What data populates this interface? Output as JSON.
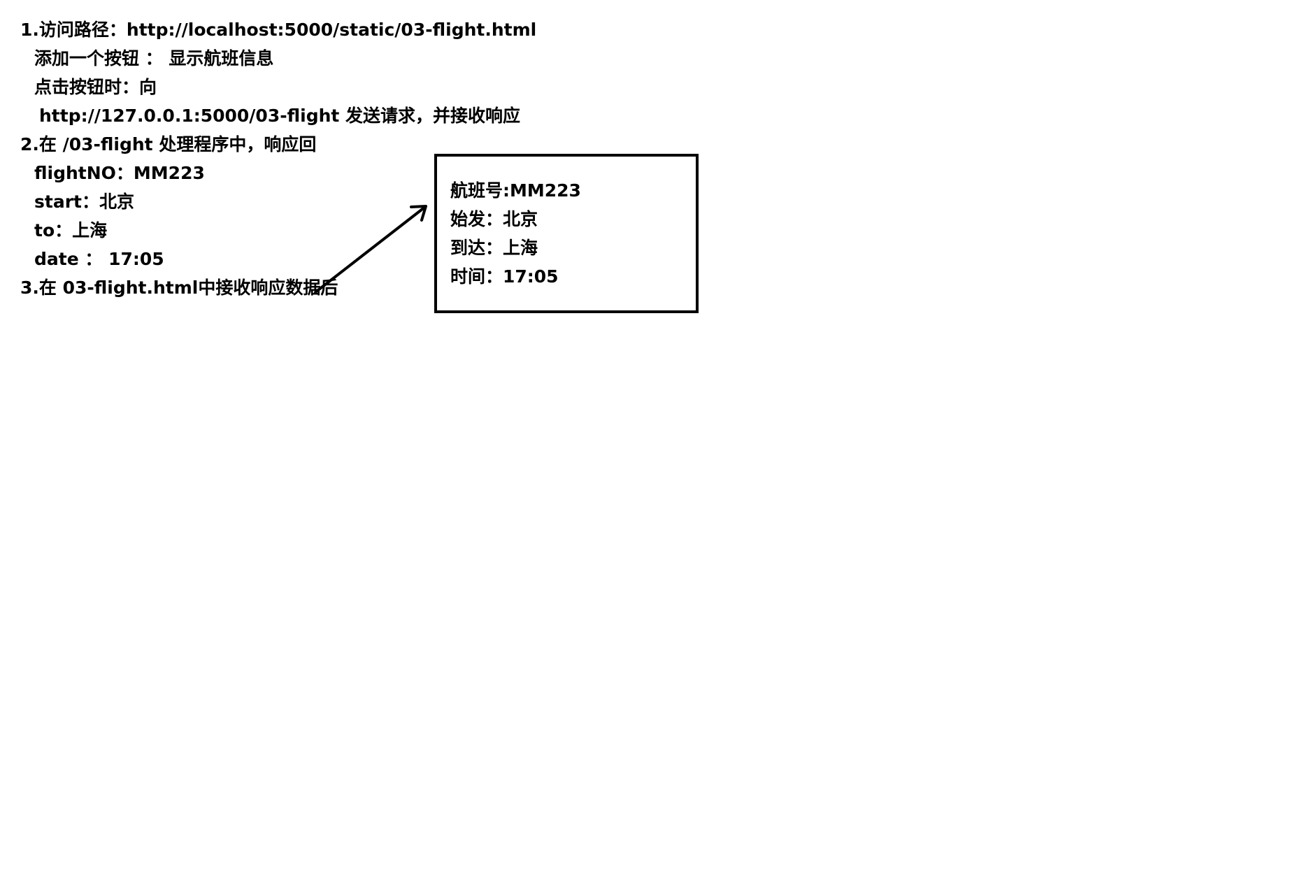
{
  "instructions": [
    {
      "text": "1.访问路径：http://localhost:5000/static/03-flight.html",
      "indent": 0
    },
    {
      "text": "添加一个按钮 ： 显示航班信息",
      "indent": 1
    },
    {
      "text": "点击按钮时：向",
      "indent": 1
    },
    {
      "text": "http://127.0.0.1:5000/03-flight  发送请求，并接收响应",
      "indent": 2
    },
    {
      "text": "2.在 /03-flight 处理程序中，响应回",
      "indent": 0
    },
    {
      "text": "flightNO：MM223",
      "indent": 1
    },
    {
      "text": "start：北京",
      "indent": 1
    },
    {
      "text": "to：上海",
      "indent": 1
    },
    {
      "text": "date ： 17:05",
      "indent": 1
    },
    {
      "text": "3.在 03-flight.html中接收响应数据后",
      "indent": 0
    }
  ],
  "result_box": {
    "lines": [
      "航班号:MM223",
      "始发：北京",
      "到达：上海",
      "时间：17:05"
    ]
  }
}
